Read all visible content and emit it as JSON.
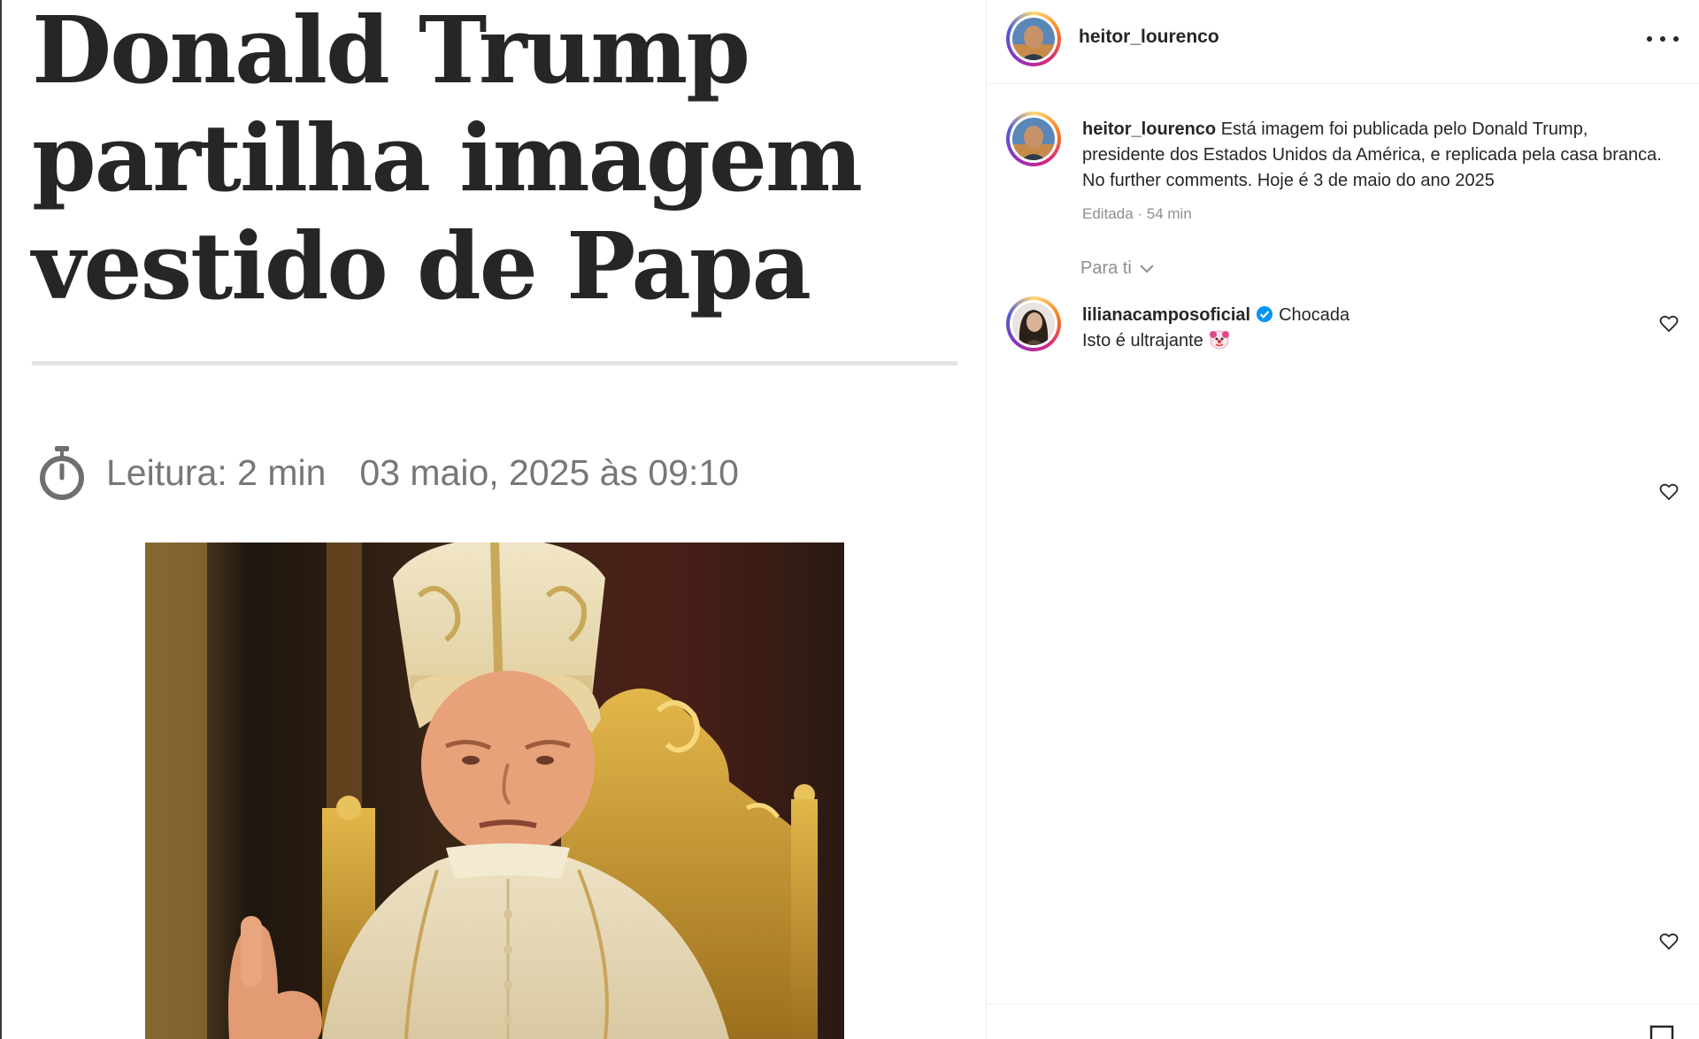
{
  "article": {
    "headline_lines": [
      "Donald Trump",
      "partilha imagem",
      "vestido de Papa"
    ],
    "reading_time": "Leitura: 2 min",
    "date": "03 maio, 2025 às 09:10",
    "timer_icon": "stopwatch-icon"
  },
  "post": {
    "header_username": "heitor_lourenco",
    "more_icon": "more-options-icon",
    "caption": {
      "username": "heitor_lourenco",
      "text": "Está imagem foi publicada pelo Donald Trump, presidente dos Estados Unidos da América, e replicada pela casa branca. No further comments. Hoje é 3 de maio do ano 2025",
      "meta": "Editada · 54 min"
    },
    "sort_label": "Para ti"
  },
  "comments": [
    {
      "username": "lilianacamposoficial",
      "verified": true,
      "line1": "Chocada",
      "line2": "Isto é ultrajante",
      "emoji": "clown-face-icon"
    }
  ],
  "colors": {
    "text_primary": "#262626",
    "text_secondary": "#8e8e8e",
    "verified_blue": "#0095f6",
    "headline": "#262626"
  }
}
